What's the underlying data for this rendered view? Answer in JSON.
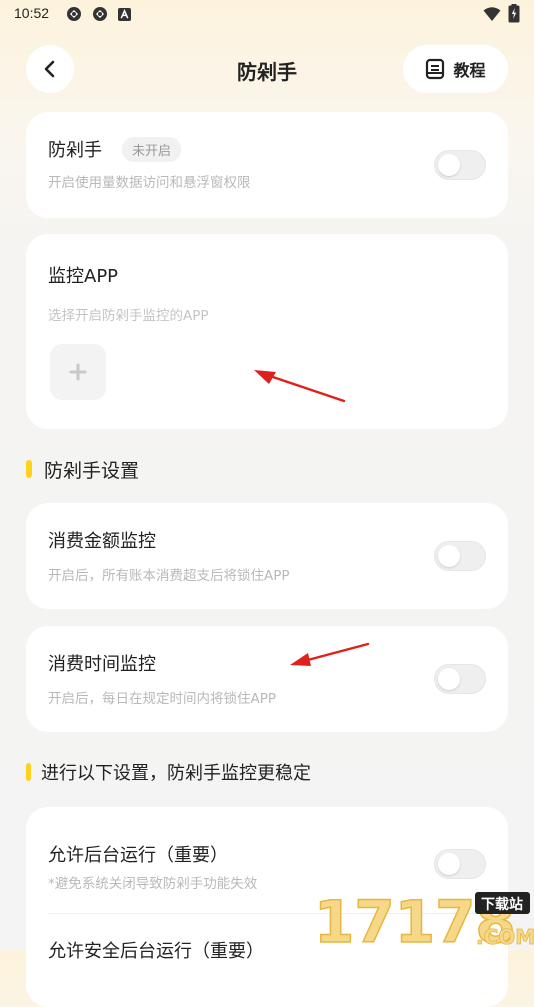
{
  "status_bar": {
    "time": "10:52",
    "left_icons": [
      "sync-icon",
      "sync-icon",
      "a-icon"
    ],
    "right_icons": [
      "wifi-icon",
      "battery-icon"
    ]
  },
  "nav": {
    "title": "防剁手",
    "tutorial_label": "教程",
    "back_icon": "chevron-left-icon",
    "tutorial_icon": "book-icon"
  },
  "card_main": {
    "title": "防剁手",
    "badge": "未开启",
    "subtitle": "开启使用量数据访问和悬浮窗权限",
    "toggle_on": false
  },
  "card_monitor": {
    "title": "监控APP",
    "subtitle": "选择开启防剁手监控的APP",
    "add_icon": "plus-icon"
  },
  "section_settings": {
    "title": "防剁手设置"
  },
  "card_amount": {
    "title": "消费金额监控",
    "subtitle": "开启后，所有账本消费超支后将锁住APP",
    "toggle_on": false
  },
  "card_time": {
    "title": "消费时间监控",
    "subtitle": "开启后，每日在规定时间内将锁住APP",
    "toggle_on": false
  },
  "section_stability": {
    "title": "进行以下设置，防剁手监控更稳定"
  },
  "card_background": {
    "item1_title": "允许后台运行（重要）",
    "item1_subtitle": "*避免系统关闭导致防剁手功能失效",
    "item1_toggle_on": false,
    "item2_title": "允许安全后台运行（重要）"
  },
  "watermark": {
    "text": "17178",
    "badge": "下载站",
    "suffix": ".COM"
  },
  "colors": {
    "accent_yellow": "#ffd21e",
    "arrow_red": "#e0201a"
  }
}
